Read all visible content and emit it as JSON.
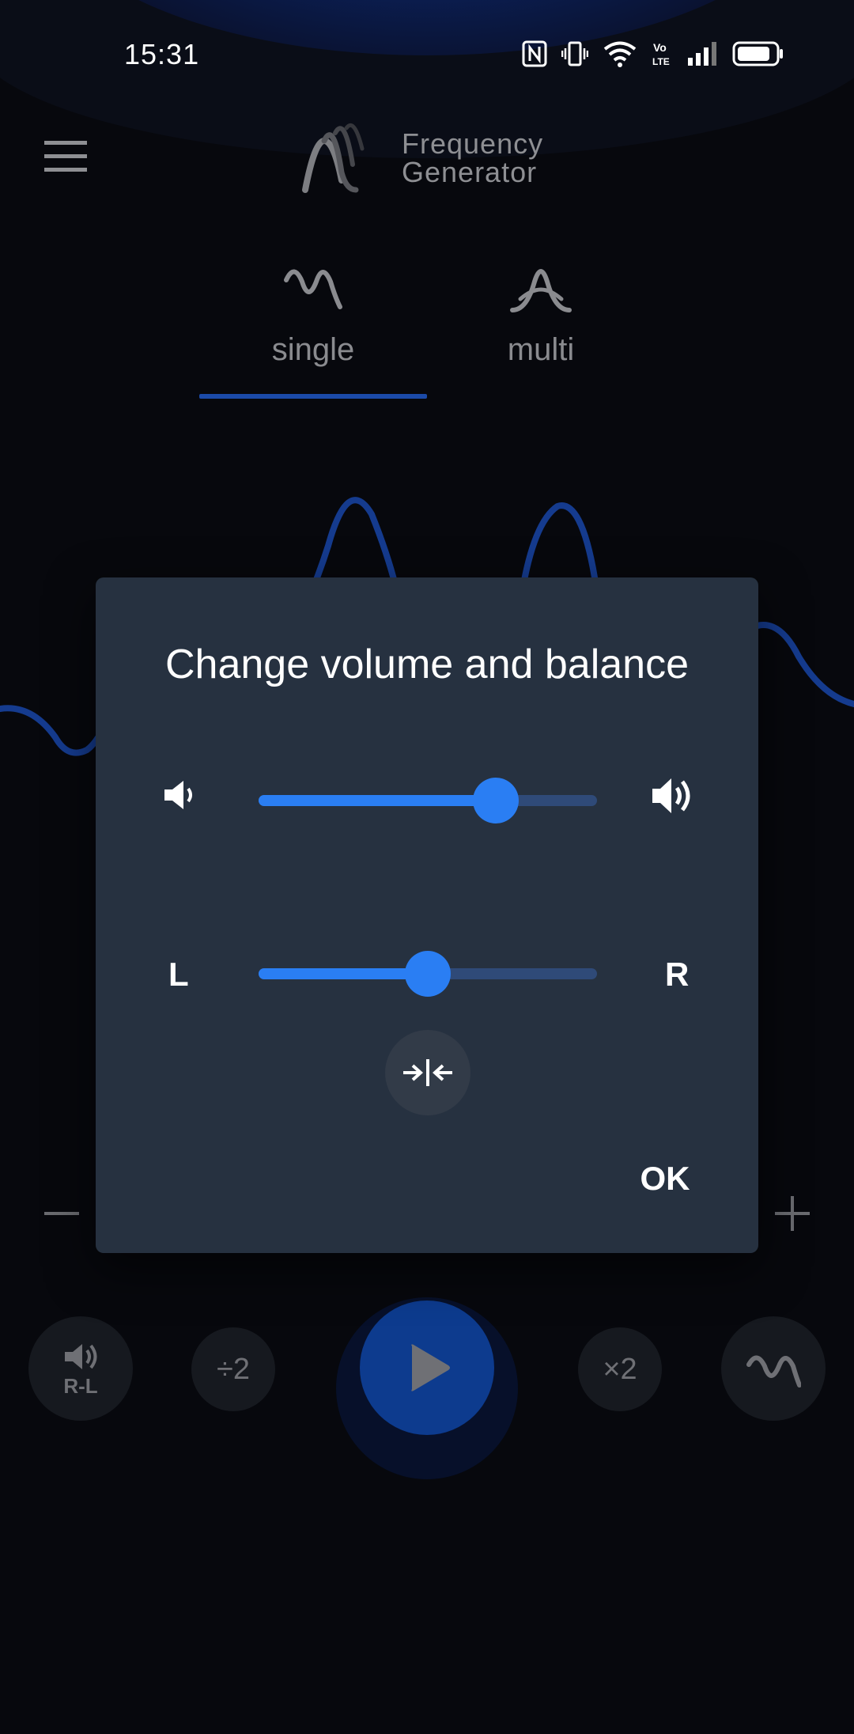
{
  "status_bar": {
    "time": "15:31",
    "icons": [
      "nfc-icon",
      "vibrate-icon",
      "wifi-icon",
      "volte-icon",
      "signal-icon",
      "battery-icon"
    ],
    "volte_text": "Vo\nLTE"
  },
  "header": {
    "title_line1": "Frequency",
    "title_line2": "Generator",
    "menu_icon": "hamburger-menu-icon",
    "logo_icon": "frequency-generator-logo"
  },
  "tabs": [
    {
      "label": "single",
      "icon": "single-wave-icon",
      "selected": true
    },
    {
      "label": "multi",
      "icon": "multi-wave-icon",
      "selected": false
    }
  ],
  "controls": {
    "swap_label": "R-L",
    "divide_label": "÷2",
    "multiply_label": "×2",
    "play_icon": "play-icon",
    "waveform_icon": "sine-wave-icon",
    "minus_icon": "minus-icon",
    "plus_icon": "plus-icon"
  },
  "dialog": {
    "title": "Change volume and balance",
    "volume": {
      "value_fraction": 0.7,
      "low_icon": "volume-low-icon",
      "high_icon": "volume-high-icon"
    },
    "balance": {
      "value_fraction": 0.5,
      "left_label": "L",
      "right_label": "R"
    },
    "center_button_icon": "center-balance-icon",
    "ok_label": "OK"
  },
  "colors": {
    "accent": "#2a7ef3",
    "track_inactive": "#2f4a78",
    "dialog_bg": "#263140",
    "wave": "#1b4aa8"
  }
}
